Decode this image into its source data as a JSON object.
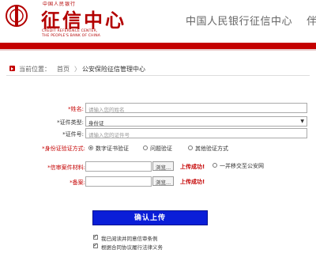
{
  "header": {
    "top_line": "中国人民银行",
    "title": "征信中心",
    "en_line1": "CREDIT REFERENCE CENTER,",
    "en_line2": "THE PEOPLE'S BANK OF CHINA",
    "right_text": "中国人民银行征信中心　 伴您"
  },
  "breadcrumb": {
    "label": "当前位置：",
    "home": "首页",
    "sep": "〉",
    "current": "公安保险征信管理中心"
  },
  "form": {
    "name": {
      "label": "*姓名:",
      "placeholder": "请输入您的姓名"
    },
    "id_type": {
      "label": "*证件类型:",
      "value": "身份证"
    },
    "id_number": {
      "label": "*证件号:",
      "placeholder": "请输入您的证件号"
    },
    "verify": {
      "label": "*身份证验证方式:",
      "options": [
        "数字证书验证",
        "问题验证",
        "其他验证方式"
      ]
    },
    "material": {
      "label": "*信审案件材料:",
      "browse": "浏览...",
      "status": "上传成功!",
      "extra_option": "一并移交至公安网"
    },
    "note": {
      "label": "*备案:",
      "browse": "浏览...",
      "status": "上传成功!"
    }
  },
  "submit": {
    "label": "确认上传"
  },
  "agreements": [
    "我已阅读并同意信审条例",
    "根据合同协议履行法律义务"
  ],
  "colors": {
    "brand_red": "#c40000",
    "submit_blue": "#0a1ed8"
  }
}
